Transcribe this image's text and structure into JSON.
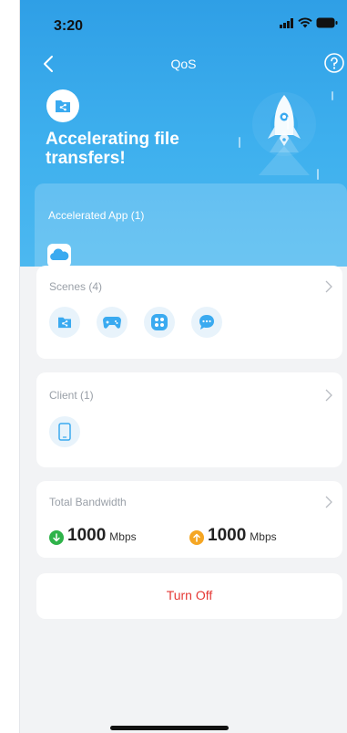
{
  "status_bar": {
    "time": "3:20"
  },
  "nav": {
    "title": "QoS"
  },
  "hero": {
    "headline_line1": "Accelerating file",
    "headline_line2": "transfers!"
  },
  "accelerated_app": {
    "label": "Accelerated App (1)",
    "apps": [
      "cloud"
    ]
  },
  "scenes": {
    "label": "Scenes (4)",
    "icons": [
      "file-share-icon",
      "gamepad-icon",
      "apps-grid-icon",
      "chat-bubble-icon"
    ]
  },
  "client": {
    "label": "Client (1)",
    "devices": [
      "phone-icon"
    ]
  },
  "bandwidth": {
    "label": "Total Bandwidth",
    "download": {
      "value": "1000",
      "unit": "Mbps",
      "color": "#2fb34a"
    },
    "upload": {
      "value": "1000",
      "unit": "Mbps",
      "color": "#f5a623"
    }
  },
  "actions": {
    "turn_off": "Turn Off"
  },
  "colors": {
    "accent": "#3aaaf0",
    "danger": "#e53935"
  }
}
